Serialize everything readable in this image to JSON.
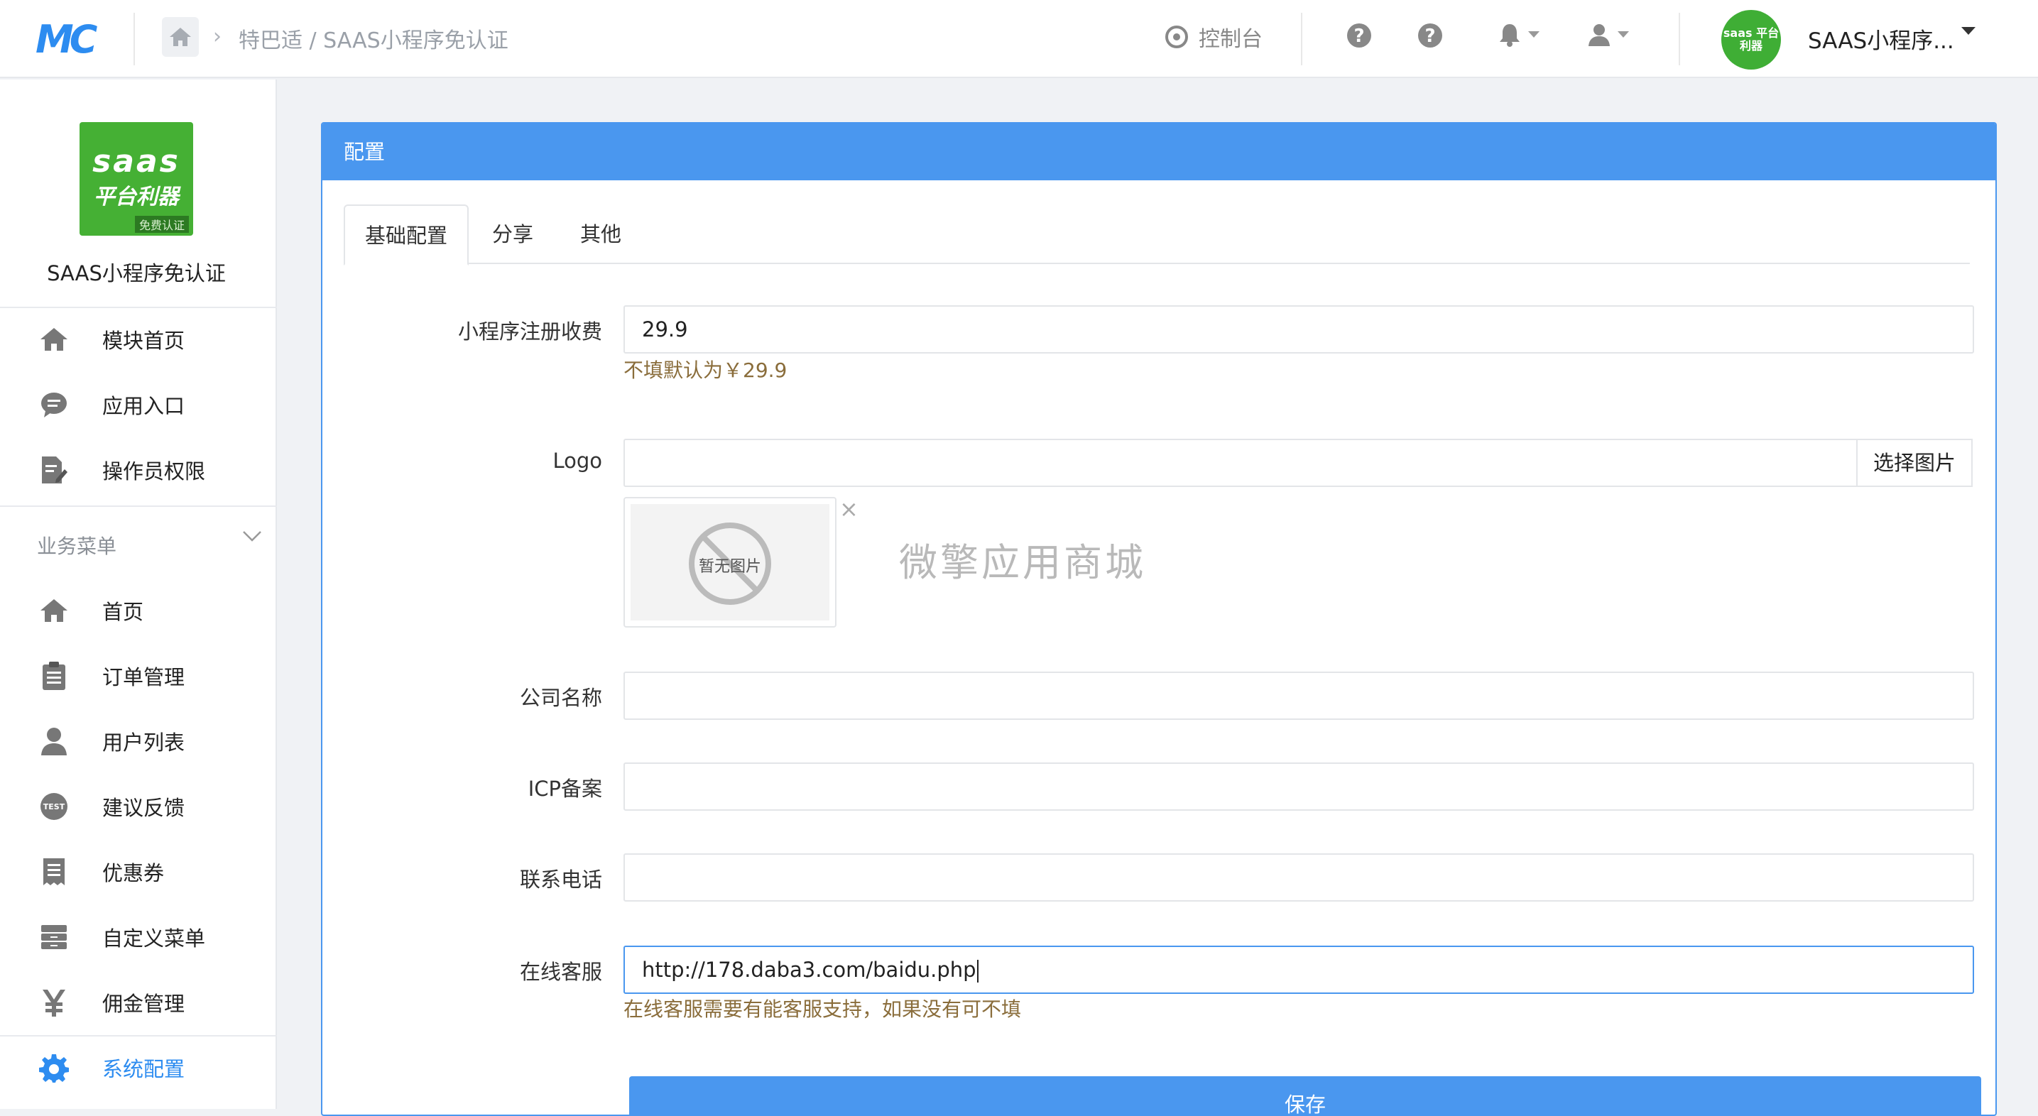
{
  "topbar": {
    "logo_text": "MC",
    "breadcrumb": "特巴适 / SAAS小程序免认证",
    "console_label": "控制台",
    "account_name": "SAAS小程序...",
    "avatar_text": "saas 平台利器"
  },
  "sidebar": {
    "brand_logo": {
      "line1": "saas",
      "line2": "平台利器",
      "line3": "免费认证"
    },
    "brand_name": "SAAS小程序免认证",
    "top_items": [
      {
        "label": "模块首页",
        "icon": "home-icon"
      },
      {
        "label": "应用入口",
        "icon": "chat-icon"
      },
      {
        "label": "操作员权限",
        "icon": "edit-doc-icon"
      }
    ],
    "group_title": "业务菜单",
    "items": [
      {
        "label": "首页",
        "icon": "home-icon"
      },
      {
        "label": "订单管理",
        "icon": "clipboard-icon"
      },
      {
        "label": "用户列表",
        "icon": "user-icon"
      },
      {
        "label": "建议反馈",
        "icon": "test-badge-icon",
        "badge_text": "TEST"
      },
      {
        "label": "优惠券",
        "icon": "receipt-icon"
      },
      {
        "label": "自定义菜单",
        "icon": "drawer-icon"
      },
      {
        "label": "佣金管理",
        "icon": "yen-icon"
      },
      {
        "label": "系统配置",
        "icon": "gear-icon",
        "active": true
      }
    ]
  },
  "panel": {
    "title": "配置",
    "tabs": [
      {
        "label": "基础配置",
        "active": true
      },
      {
        "label": "分享"
      },
      {
        "label": "其他"
      }
    ],
    "fields": {
      "fee": {
        "label": "小程序注册收费",
        "value": "29.9",
        "help": "不填默认为￥29.9"
      },
      "logo": {
        "label": "Logo",
        "value": "",
        "button": "选择图片",
        "no_image": "暂无图片",
        "close": "×"
      },
      "company": {
        "label": "公司名称",
        "value": ""
      },
      "icp": {
        "label": "ICP备案",
        "value": ""
      },
      "phone": {
        "label": "联系电话",
        "value": ""
      },
      "service": {
        "label": "在线客服",
        "value": "http://178.daba3.com/baidu.php",
        "help": "在线客服需要有能客服支持，如果没有可不填"
      }
    },
    "watermark": "微擎应用商城",
    "save_label": "保存"
  },
  "colors": {
    "accent": "#4a97ef",
    "help_text": "#8a6d3b",
    "brand_green": "#45b034"
  }
}
